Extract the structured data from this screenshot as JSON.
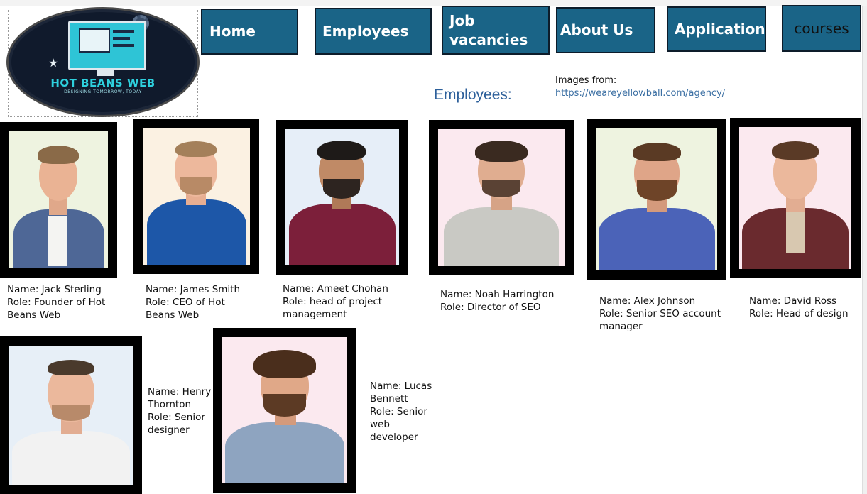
{
  "logo": {
    "title": "HOT BEANS WEB",
    "subtitle": "DESIGNING TOMORROW, TODAY"
  },
  "nav": {
    "home": "Home",
    "employees": "Employees",
    "job_vacancies": "Job vacancies",
    "about_us": "About Us",
    "application": "Application",
    "courses": "courses"
  },
  "main": {
    "section_title": "Employees:",
    "credit_label": "Images from:",
    "credit_link": "https://weareyellowball.com/agency/"
  },
  "employees": [
    {
      "name": "Name: Jack Sterling",
      "role": "Role: Founder of Hot Beans Web"
    },
    {
      "name": "Name: James Smith",
      "role": "Role: CEO of Hot Beans Web"
    },
    {
      "name": "Name: Ameet Chohan",
      "role": "Role: head of project management"
    },
    {
      "name": "Name: Noah Harrington",
      "role": "Role: Director of SEO"
    },
    {
      "name": "Name: Alex Johnson",
      "role": "Role: Senior SEO account manager"
    },
    {
      "name": "Name: David Ross",
      "role": "Role: Head of design"
    },
    {
      "name": "Name: Henry Thornton",
      "role": "Role: Senior designer"
    },
    {
      "name": "Name: Lucas Bennett",
      "role": "Role: Senior web developer"
    }
  ],
  "colors": {
    "nav_button": "#1a6487",
    "nav_border": "#0d1c2a",
    "section_title": "#2c5f9a",
    "link": "#3b6fa3",
    "logo_bg": "#101a2c",
    "logo_text": "#2ed0de"
  }
}
